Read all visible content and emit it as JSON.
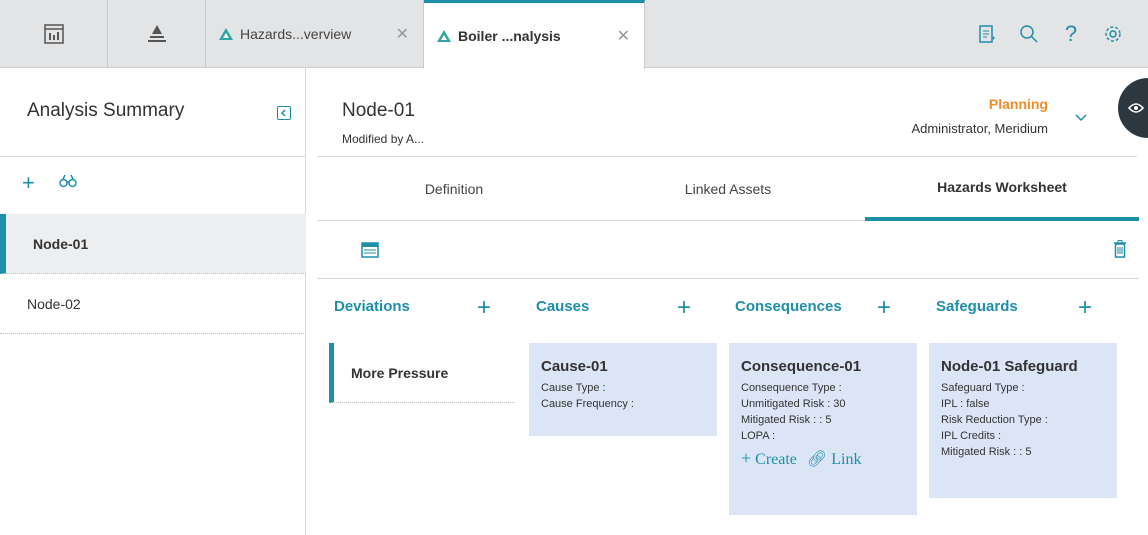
{
  "tabs": [
    {
      "label": "Hazards...verview"
    },
    {
      "label": "Boiler ...nalysis"
    }
  ],
  "left": {
    "title": "Analysis Summary",
    "nodes": [
      {
        "label": "Node-01"
      },
      {
        "label": "Node-02"
      }
    ]
  },
  "header": {
    "node_title": "Node-01",
    "modified": "Modified by A...",
    "status": "Planning",
    "owner": "Administrator, Meridium"
  },
  "subtabs": [
    {
      "label": "Definition"
    },
    {
      "label": "Linked Assets"
    },
    {
      "label": "Hazards Worksheet"
    }
  ],
  "columns": {
    "deviations": {
      "title": "Deviations",
      "items": [
        "More Pressure"
      ]
    },
    "causes": {
      "title": "Causes"
    },
    "consequences": {
      "title": "Consequences"
    },
    "safeguards": {
      "title": "Safeguards"
    }
  },
  "cause_card": {
    "title": "Cause-01",
    "lines": [
      "Cause Type :",
      "Cause Frequency :"
    ]
  },
  "consequence_card": {
    "title": "Consequence-01",
    "lines": [
      "Consequence Type :",
      "Unmitigated Risk : 30",
      "Mitigated Risk : : 5",
      "LOPA :"
    ],
    "create_label": "Create",
    "link_label": "Link"
  },
  "safeguard_card": {
    "title": "Node-01 Safeguard",
    "lines": [
      "Safeguard Type :",
      "IPL : false",
      "Risk Reduction Type :",
      "IPL Credits :",
      "Mitigated Risk : : 5"
    ]
  },
  "colors": {
    "accent": "#1e8fa8",
    "status": "#f28c28",
    "card_bg": "#dbe5f5"
  }
}
